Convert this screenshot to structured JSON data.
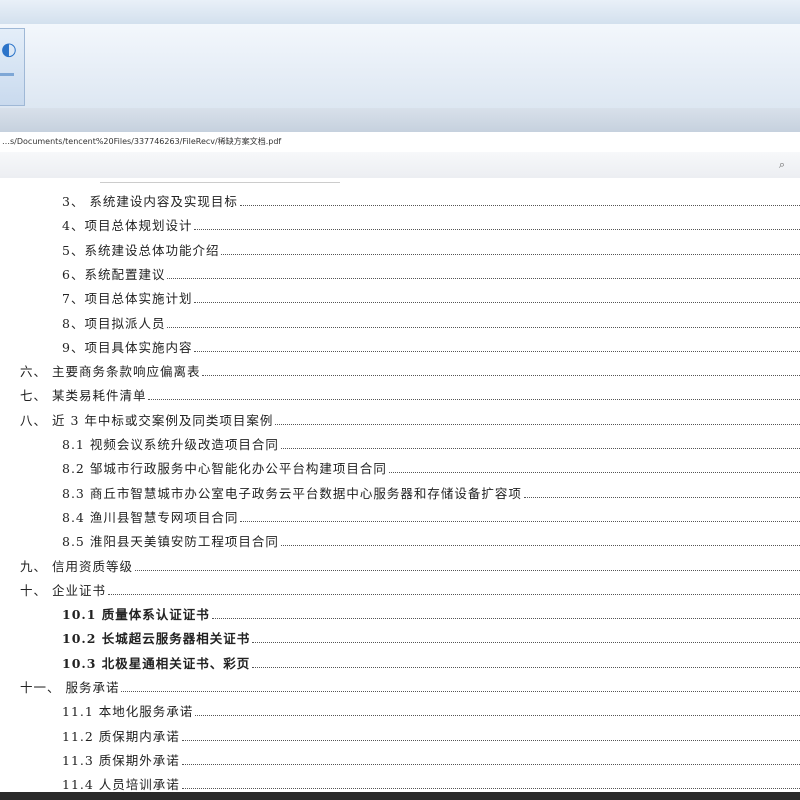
{
  "window": {
    "address": "…s/Documents/tencent%20Files/337746263/FileRecv/稀缺方案文档.pdf",
    "tool_icon": "search-icon"
  },
  "toc": [
    {
      "text": "3、  系统建设内容及实现目标",
      "indent": 62,
      "bold": false
    },
    {
      "text": "4、项目总体规划设计",
      "indent": 62,
      "bold": false
    },
    {
      "text": "5、系统建设总体功能介绍",
      "indent": 62,
      "bold": false
    },
    {
      "text": "6、系统配置建议",
      "indent": 62,
      "bold": false
    },
    {
      "text": "7、项目总体实施计划",
      "indent": 62,
      "bold": false
    },
    {
      "text": "8、项目拟派人员",
      "indent": 62,
      "bold": false
    },
    {
      "text": "9、项目具体实施内容",
      "indent": 62,
      "bold": false
    },
    {
      "text": "六、  主要商务条款响应偏离表",
      "indent": 20,
      "bold": false
    },
    {
      "text": "七、  某类易耗件清单",
      "indent": 20,
      "bold": false
    },
    {
      "text": "八、  近 3 年中标或交案例及同类项目案例",
      "indent": 20,
      "bold": false
    },
    {
      "text": "8.1 视频会议系统升级改造项目合同",
      "indent": 62,
      "bold": false
    },
    {
      "text": "8.2 邹城市行政服务中心智能化办公平台构建项目合同",
      "indent": 62,
      "bold": false
    },
    {
      "text": "8.3 商丘市智慧城市办公室电子政务云平台数据中心服务器和存储设备扩容项",
      "indent": 62,
      "bold": false
    },
    {
      "text": "8.4 渔川县智慧专网项目合同",
      "indent": 62,
      "bold": false
    },
    {
      "text": "8.5 淮阳县天美镇安防工程项目合同",
      "indent": 62,
      "bold": false
    },
    {
      "text": "九、  信用资质等级",
      "indent": 20,
      "bold": false
    },
    {
      "text": "十、  企业证书",
      "indent": 20,
      "bold": false
    },
    {
      "text": "10.1 质量体系认证证书",
      "indent": 62,
      "bold": true
    },
    {
      "text": "10.2 长城超云服务器相关证书",
      "indent": 62,
      "bold": true
    },
    {
      "text": "10.3 北极星通相关证书、彩页",
      "indent": 62,
      "bold": true
    },
    {
      "text": "十一、  服务承诺",
      "indent": 20,
      "bold": false
    },
    {
      "text": "11.1 本地化服务承诺",
      "indent": 62,
      "bold": false
    },
    {
      "text": "11.2 质保期内承诺",
      "indent": 62,
      "bold": false
    },
    {
      "text": "11.3 质保期外承诺",
      "indent": 62,
      "bold": false
    },
    {
      "text": "11.4 人员培训承诺",
      "indent": 62,
      "bold": false
    }
  ]
}
